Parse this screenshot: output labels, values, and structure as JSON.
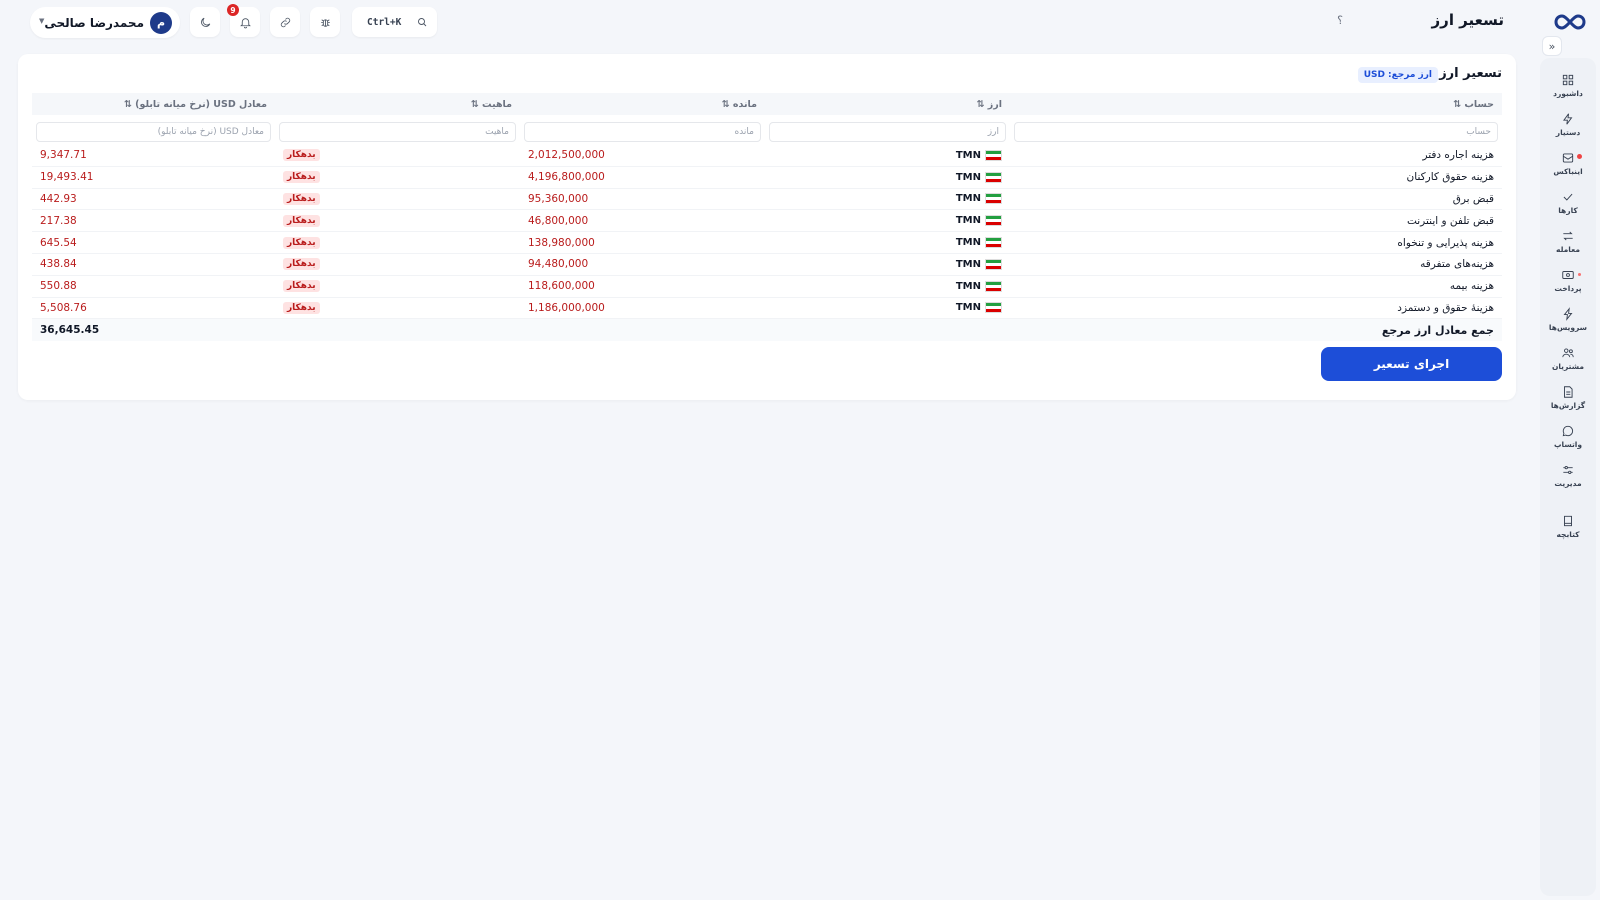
{
  "header": {
    "title": "تسعیر ارز",
    "help_icon": "question-mark",
    "user_name": "محمدرضا صالحی",
    "user_initial": "م",
    "notification_count": "9",
    "search_shortcut": "Ctrl+K"
  },
  "sidebar": {
    "items": [
      {
        "label": "داشبورد",
        "icon": "grid-icon"
      },
      {
        "label": "دستیار",
        "icon": "bolt-icon"
      },
      {
        "label": "اینباکس",
        "icon": "inbox-icon"
      },
      {
        "label": "کارها",
        "icon": "check-icon"
      },
      {
        "label": "معامله",
        "icon": "swap-icon"
      },
      {
        "label": "پرداخت",
        "icon": "cash-icon"
      },
      {
        "label": "سرویس‌ها",
        "icon": "flash-icon"
      },
      {
        "label": "مشتریان",
        "icon": "users-icon"
      },
      {
        "label": "گزارش‌ها",
        "icon": "report-icon"
      },
      {
        "label": "واتساپ",
        "icon": "chat-icon"
      },
      {
        "label": "مدیریت",
        "icon": "sliders-icon"
      },
      {
        "label": "کتابچه",
        "icon": "book-icon"
      }
    ]
  },
  "card": {
    "title": "تسعیر ارز",
    "ref_currency_label": "ارز مرجع:",
    "ref_currency_value": "USD"
  },
  "table": {
    "columns": {
      "account": "حساب ⇅",
      "currency": "ارز ⇅",
      "balance": "مانده ⇅",
      "nature": "ماهیت ⇅",
      "usd": "معادل USD (نرخ میانه تابلو) ⇅"
    },
    "filters": {
      "account": "حساب",
      "currency": "ارز",
      "balance": "مانده",
      "nature": "ماهیت",
      "usd": "معادل USD (نرخ میانه تابلو)"
    },
    "rows": [
      {
        "account": "هزینه اجاره دفتر",
        "currency": "TMN",
        "balance": "2,012,500,000",
        "nature": "بدهکار",
        "usd": "9,347.71"
      },
      {
        "account": "هزینه حقوق کارکنان",
        "currency": "TMN",
        "balance": "4,196,800,000",
        "nature": "بدهکار",
        "usd": "19,493.41"
      },
      {
        "account": "قبض برق",
        "currency": "TMN",
        "balance": "95,360,000",
        "nature": "بدهکار",
        "usd": "442.93"
      },
      {
        "account": "قبض تلفن و اینترنت",
        "currency": "TMN",
        "balance": "46,800,000",
        "nature": "بدهکار",
        "usd": "217.38"
      },
      {
        "account": "هزینه پذیرایی و تنخواه",
        "currency": "TMN",
        "balance": "138,980,000",
        "nature": "بدهکار",
        "usd": "645.54"
      },
      {
        "account": "هزینه‌های متفرقه",
        "currency": "TMN",
        "balance": "94,480,000",
        "nature": "بدهکار",
        "usd": "438.84"
      },
      {
        "account": "هزینه بیمه",
        "currency": "TMN",
        "balance": "118,600,000",
        "nature": "بدهکار",
        "usd": "550.88"
      },
      {
        "account": "هزینهٔ حقوق و دستمزد",
        "currency": "TMN",
        "balance": "1,186,000,000",
        "nature": "بدهکار",
        "usd": "5,508.76"
      }
    ],
    "total_label": "جمع معادل ارز مرجع",
    "total_value": "36,645.45"
  },
  "actions": {
    "run_label": "اجرای تسعیر"
  },
  "colors": {
    "primary": "#1d4ed8",
    "debit": "#b91c1c",
    "debit_bg": "#fee2e2",
    "avatar": "#1e3a8a"
  }
}
